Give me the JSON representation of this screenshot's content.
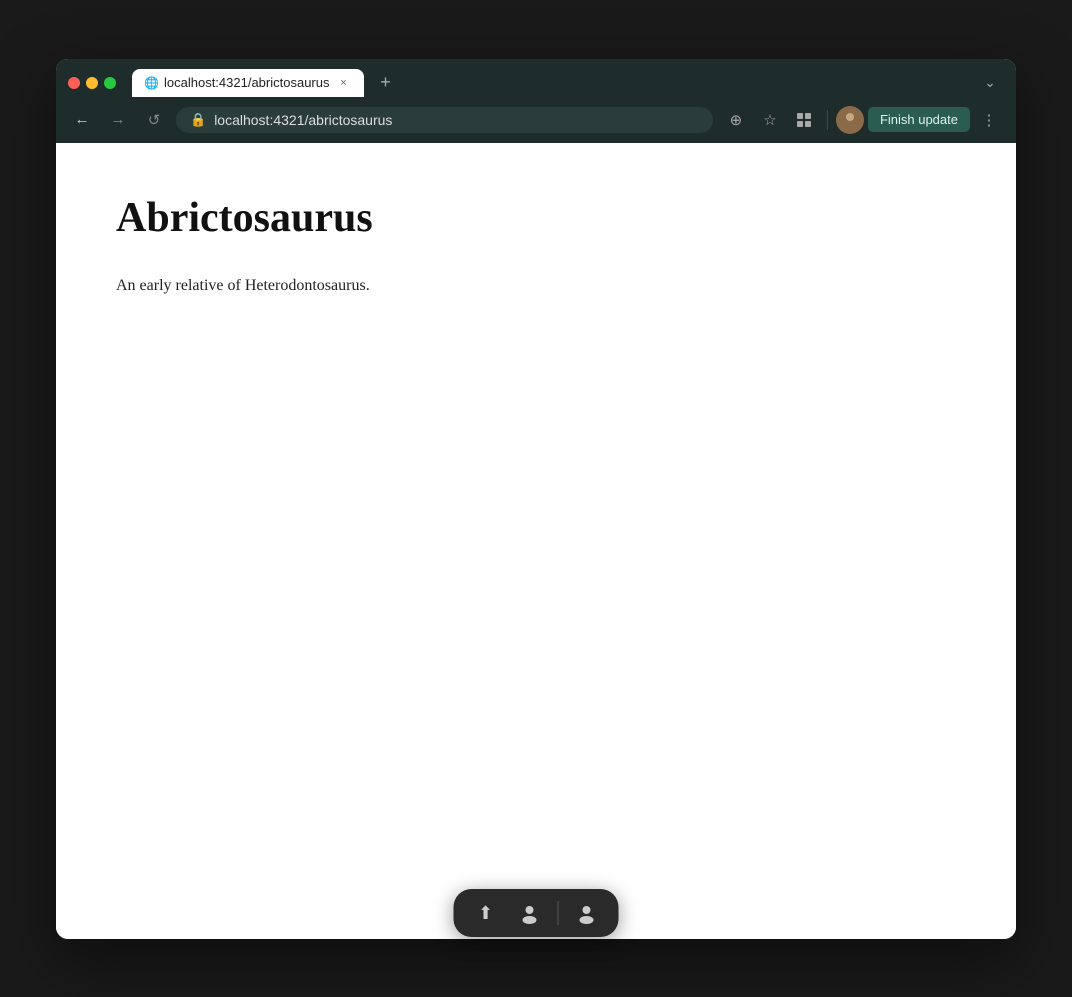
{
  "browser": {
    "tab": {
      "favicon": "🌐",
      "title": "localhost:4321/abrictosaurus",
      "close_label": "×"
    },
    "new_tab_label": "+",
    "expand_label": "⌄",
    "nav": {
      "back_label": "←",
      "forward_label": "→",
      "reload_label": "↺",
      "address": "localhost:4321/abrictosaurus",
      "address_icon": "🔒",
      "zoom_icon": "⊕",
      "bookmark_icon": "☆",
      "extensions_icon": "⬜",
      "finish_update_label": "Finish update",
      "more_label": "⋮"
    }
  },
  "page": {
    "title": "Abrictosaurus",
    "description": "An early relative of Heterodontosaurus."
  },
  "dock": {
    "icons": [
      "⬆",
      "👤",
      "—",
      "👤"
    ],
    "separator_index": 2
  }
}
